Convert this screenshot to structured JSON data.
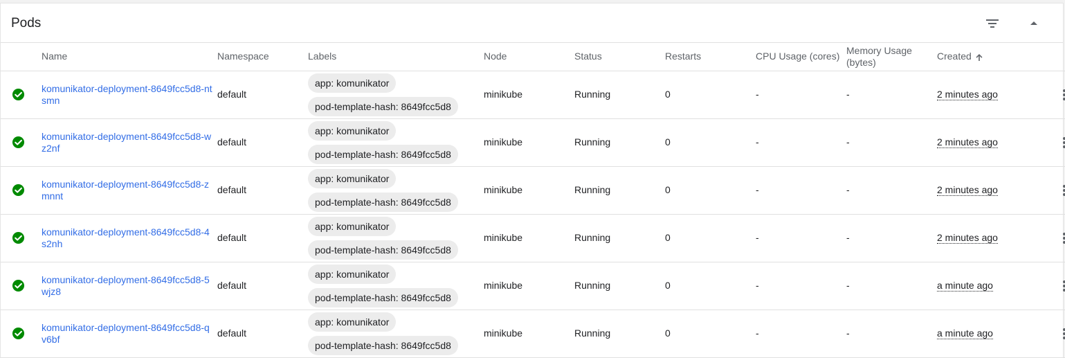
{
  "card": {
    "title": "Pods",
    "filter_icon": "filter-list-icon",
    "collapse_icon": "arrow-drop-up-icon"
  },
  "table": {
    "columns": {
      "name": "Name",
      "namespace": "Namespace",
      "labels": "Labels",
      "node": "Node",
      "status": "Status",
      "restarts": "Restarts",
      "cpu": "CPU Usage (cores)",
      "memory": "Memory Usage (bytes)",
      "created": "Created"
    },
    "sort_icon": "arrow-upward-icon",
    "rows": [
      {
        "status_icon": "check-circle-icon",
        "name": "komunikator-deployment-8649fcc5d8-ntsmn",
        "namespace": "default",
        "labels": [
          "app: komunikator",
          "pod-template-hash: 8649fcc5d8"
        ],
        "node": "minikube",
        "status": "Running",
        "restarts": "0",
        "cpu": "-",
        "memory": "-",
        "created": "2 minutes ago"
      },
      {
        "status_icon": "check-circle-icon",
        "name": "komunikator-deployment-8649fcc5d8-wz2nf",
        "namespace": "default",
        "labels": [
          "app: komunikator",
          "pod-template-hash: 8649fcc5d8"
        ],
        "node": "minikube",
        "status": "Running",
        "restarts": "0",
        "cpu": "-",
        "memory": "-",
        "created": "2 minutes ago"
      },
      {
        "status_icon": "check-circle-icon",
        "name": "komunikator-deployment-8649fcc5d8-zmnnt",
        "namespace": "default",
        "labels": [
          "app: komunikator",
          "pod-template-hash: 8649fcc5d8"
        ],
        "node": "minikube",
        "status": "Running",
        "restarts": "0",
        "cpu": "-",
        "memory": "-",
        "created": "2 minutes ago"
      },
      {
        "status_icon": "check-circle-icon",
        "name": "komunikator-deployment-8649fcc5d8-4s2nh",
        "namespace": "default",
        "labels": [
          "app: komunikator",
          "pod-template-hash: 8649fcc5d8"
        ],
        "node": "minikube",
        "status": "Running",
        "restarts": "0",
        "cpu": "-",
        "memory": "-",
        "created": "2 minutes ago"
      },
      {
        "status_icon": "check-circle-icon",
        "name": "komunikator-deployment-8649fcc5d8-5wjz8",
        "namespace": "default",
        "labels": [
          "app: komunikator",
          "pod-template-hash: 8649fcc5d8"
        ],
        "node": "minikube",
        "status": "Running",
        "restarts": "0",
        "cpu": "-",
        "memory": "-",
        "created": "a minute ago"
      },
      {
        "status_icon": "check-circle-icon",
        "name": "komunikator-deployment-8649fcc5d8-qv6bf",
        "namespace": "default",
        "labels": [
          "app: komunikator",
          "pod-template-hash: 8649fcc5d8"
        ],
        "node": "minikube",
        "status": "Running",
        "restarts": "0",
        "cpu": "-",
        "memory": "-",
        "created": "a minute ago"
      }
    ]
  },
  "colors": {
    "link": "#326de6",
    "status_ok": "#008a00",
    "chip_bg": "#ececec"
  }
}
